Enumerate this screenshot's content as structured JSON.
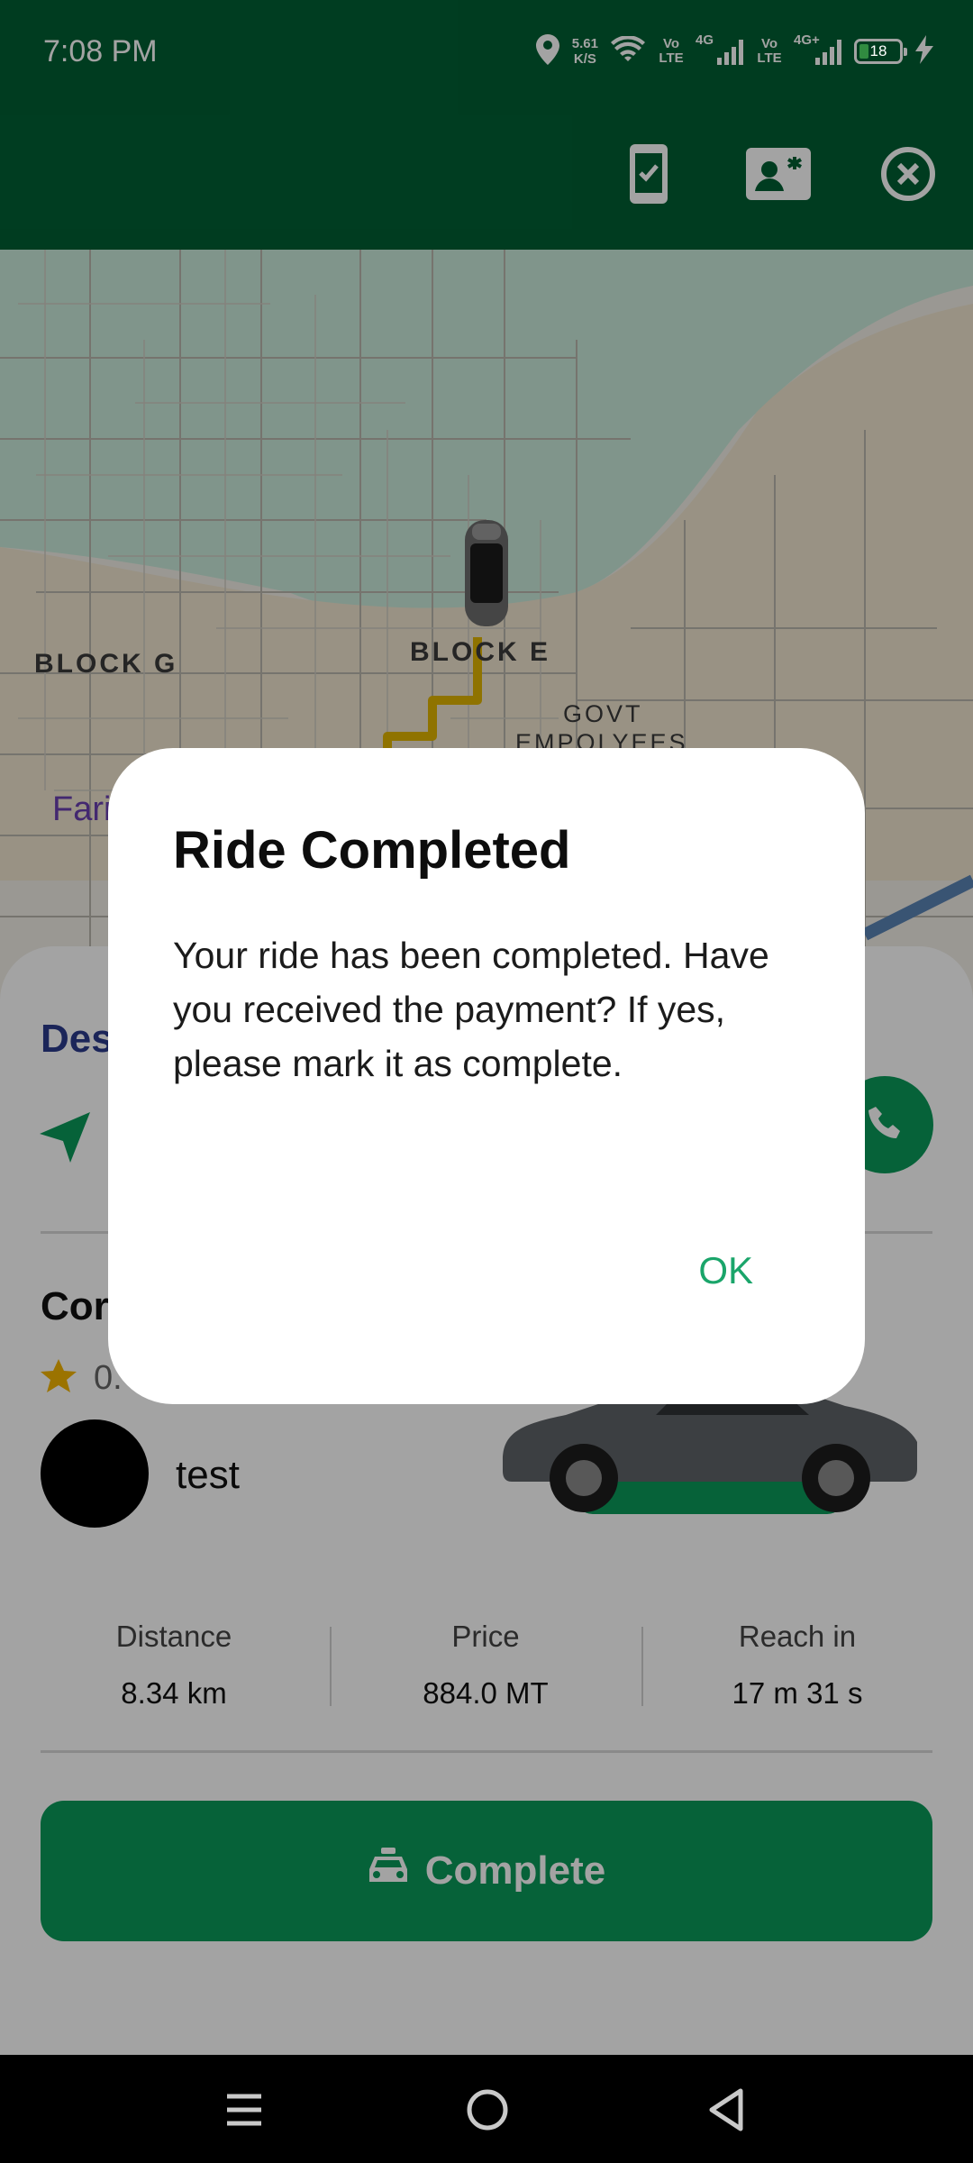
{
  "status_bar": {
    "time": "7:08 PM",
    "net_speed_value": "5.61",
    "net_speed_unit": "K/S",
    "volte_1": "Vo LTE",
    "network_1": "4G",
    "volte_2": "Vo LTE",
    "network_2": "4G+",
    "battery": "18"
  },
  "header": {
    "icons": [
      "phone-check-icon",
      "id-card-icon",
      "close-circle-icon"
    ]
  },
  "map": {
    "labels": [
      "BLOCK G",
      "BLOCK E",
      "GOVT",
      "EMPOLYEES",
      "Fari"
    ]
  },
  "sheet": {
    "destination_label_partial": "Des",
    "contact_label_partial": "Cor",
    "rating_partial": "0.",
    "driver_name": "test",
    "stats": [
      {
        "label": "Distance",
        "value": "8.34 km"
      },
      {
        "label": "Price",
        "value": "884.0 MT"
      },
      {
        "label": "Reach in",
        "value": "17 m 31 s"
      }
    ],
    "complete_button": "Complete"
  },
  "dialog": {
    "title": "Ride Completed",
    "message": "Your ride has been completed. Have you received the payment? If yes, please mark it as complete.",
    "ok_button": "OK"
  },
  "colors": {
    "header_green": "#005F33",
    "button_green": "#0a9a5a",
    "ok_green": "#1aa56a",
    "route_yellow": "#e0b400"
  }
}
